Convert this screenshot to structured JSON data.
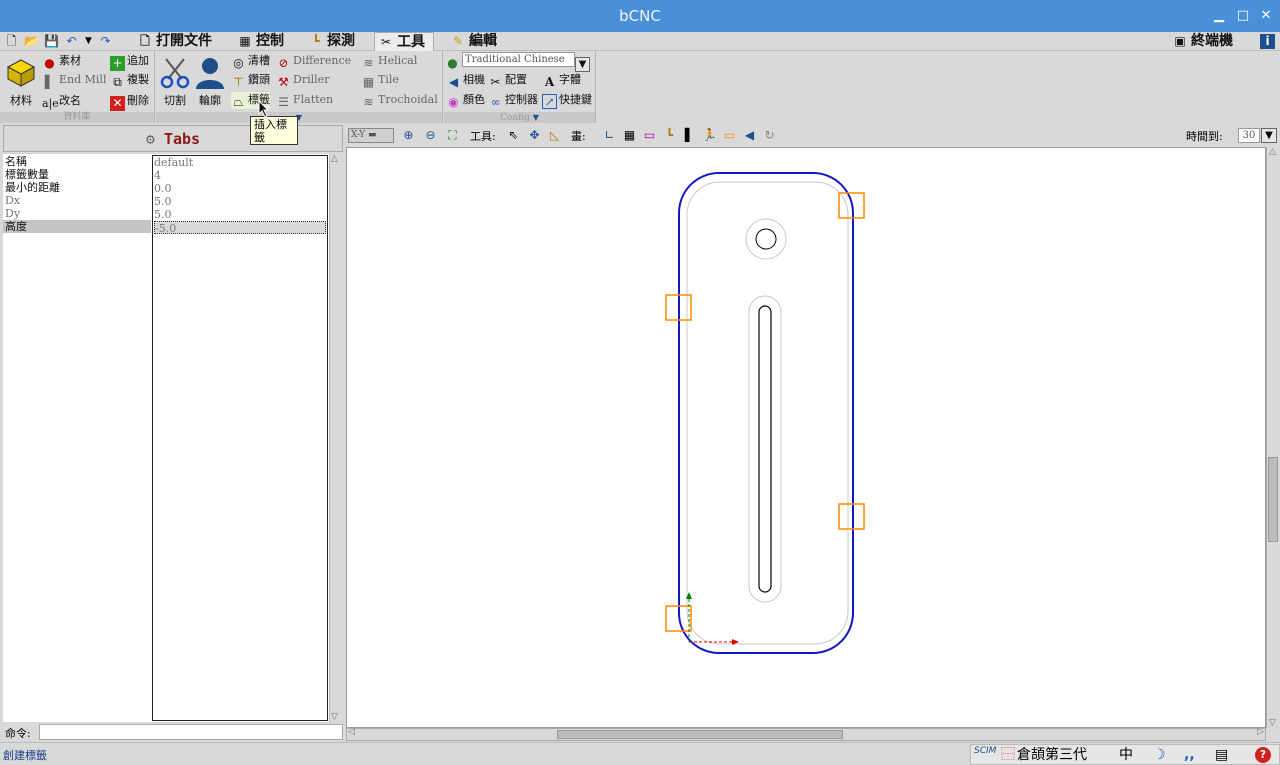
{
  "window": {
    "title": "bCNC",
    "minimize": "▁",
    "maximize": "□",
    "close": "✕"
  },
  "menu": {
    "tabs": [
      {
        "label": "打開文件",
        "icon": "file-icon"
      },
      {
        "label": "控制",
        "icon": "control-icon"
      },
      {
        "label": "探測",
        "icon": "probe-icon"
      },
      {
        "label": "工具",
        "icon": "tools-icon",
        "active": true
      },
      {
        "label": "編輯",
        "icon": "edit-icon"
      }
    ],
    "terminal": "終端機",
    "info": "i"
  },
  "ribbon": {
    "database": {
      "material": "材料",
      "stock": "素材",
      "endmill": "End Mill",
      "rename": "改名",
      "add": "追加",
      "copy": "複製",
      "delete": "刪除",
      "caption": "資料庫"
    },
    "cam": {
      "cut": "切割",
      "profile": "輪廓",
      "pocket": "清槽",
      "drill": "鑽頭",
      "tabs": "標籤",
      "difference": "Difference",
      "driller": "Driller",
      "flatten": "Flatten",
      "helical": "Helical",
      "tile": "Tile",
      "trochoidal": "Trochoidal"
    },
    "config": {
      "language": "Traditional Chinese",
      "camera": "相機",
      "configure": "配置",
      "font": "字體",
      "colors": "顏色",
      "controller": "控制器",
      "shortcuts": "快捷鍵",
      "caption": "Config"
    },
    "tooltip": "插入標籤"
  },
  "panel": {
    "title": "Tabs",
    "properties": [
      {
        "name": "名稱",
        "value": "default",
        "gray": false
      },
      {
        "name": "標籤數量",
        "value": "4",
        "gray": false
      },
      {
        "name": "最小的距離",
        "value": "0.0",
        "gray": false
      },
      {
        "name": "Dx",
        "value": "5.0",
        "gray": true
      },
      {
        "name": "Dy",
        "value": "5.0",
        "gray": true
      },
      {
        "name": "高度",
        "value": "-5.0",
        "gray": false,
        "selected": true
      }
    ]
  },
  "canvas_toolbar": {
    "view": "X-Y",
    "tool_label": "工具:",
    "draw_label": "畫:",
    "time_label": "時間到:",
    "time_value": "30"
  },
  "command": {
    "label": "命令:",
    "value": ""
  },
  "status": {
    "text": "創建標籤",
    "ime": {
      "logo": "SCIM",
      "method": "倉頡第三代",
      "mode": "中"
    }
  },
  "colors": {
    "outline": "#1515c8",
    "tab_box": "#ff8c00",
    "path": "#000000",
    "offset": "#c8c8c8",
    "x_axis": "#e00000",
    "y_axis": "#008000"
  }
}
